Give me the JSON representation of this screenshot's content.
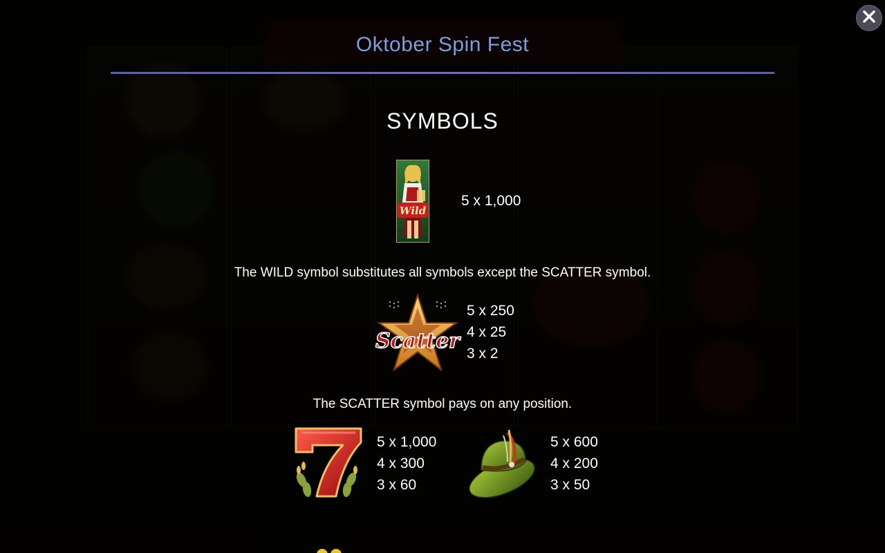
{
  "title": "Oktober Spin Fest",
  "section_heading": "SYMBOLS",
  "symbols": {
    "wild": {
      "icon": "wild-girl-symbol",
      "pays": [
        "5 x 1,000"
      ],
      "description": "The WILD symbol substitutes all symbols except the SCATTER symbol."
    },
    "scatter": {
      "icon": "scatter-star-symbol",
      "pays": [
        "5 x 250",
        "4 x 25",
        "3 x 2"
      ],
      "description": "The SCATTER symbol pays on any position."
    },
    "seven": {
      "icon": "red-seven-symbol",
      "pays": [
        "5 x 1,000",
        "4 x 300",
        "3 x 60"
      ]
    },
    "hat": {
      "icon": "green-hat-symbol",
      "pays": [
        "5 x 600",
        "4 x 200",
        "3 x 50"
      ]
    }
  },
  "colors": {
    "title": "#7f9ed9",
    "rule": "#5a5fa8",
    "text": "#ffffff",
    "close_button": "#4a4a58"
  },
  "close_icon": "close-icon"
}
